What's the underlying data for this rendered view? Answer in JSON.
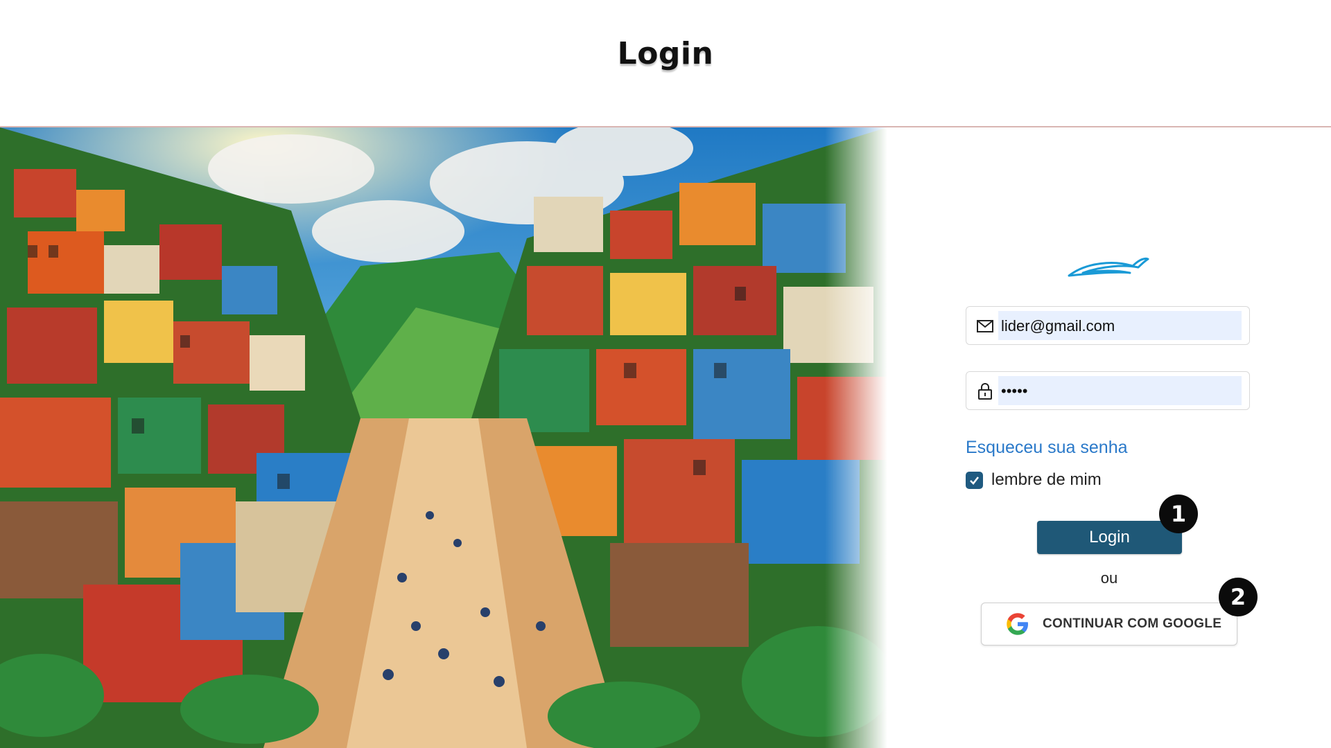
{
  "header": {
    "title": "Login"
  },
  "hero": {
    "image_alt": "colorful favela hillside painting"
  },
  "form": {
    "logo_icon": "bird-logo-icon",
    "email_value": "lider@gmail.com",
    "email_icon": "mail-icon",
    "password_value": "•••••",
    "password_icon": "lock-icon",
    "forgot_label": "Esqueceu sua senha",
    "remember_label": "lembre de mim",
    "remember_checked": true,
    "login_label": "Login",
    "or_label": "ou",
    "google_label": "CONTINUAR COM GOOGLE",
    "google_icon": "google-g-icon"
  },
  "annotations": {
    "marker_1": "1",
    "marker_2": "2"
  },
  "colors": {
    "primary": "#1f5877",
    "link": "#2a79c9",
    "autofill": "#e8f0fe",
    "logo": "#1a9ad6"
  }
}
